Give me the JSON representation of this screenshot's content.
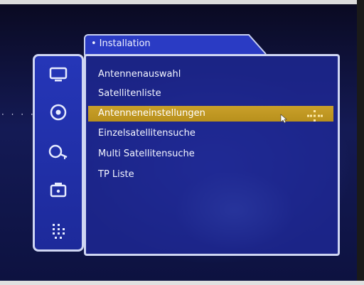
{
  "menu": {
    "title": "Installation",
    "items": [
      {
        "label": "Antennenauswahl",
        "selected": false
      },
      {
        "label": "Satellitenliste",
        "selected": false
      },
      {
        "label": "Antenneneinstellungen",
        "selected": true
      },
      {
        "label": "Einzelsatellitensuche",
        "selected": false
      },
      {
        "label": "Multi Satellitensuche",
        "selected": false
      },
      {
        "label": "TP Liste",
        "selected": false
      }
    ]
  },
  "sidebar": {
    "icons": [
      "tv-icon",
      "satellite-dish-icon",
      "key-icon",
      "media-icon",
      "settings-grid-icon"
    ],
    "active_icon": "satellite-dish-icon"
  },
  "colors": {
    "panel": "#1e2896",
    "highlight": "#c9a02a",
    "border": "#cfd6f3",
    "text": "#f4f6ff"
  }
}
